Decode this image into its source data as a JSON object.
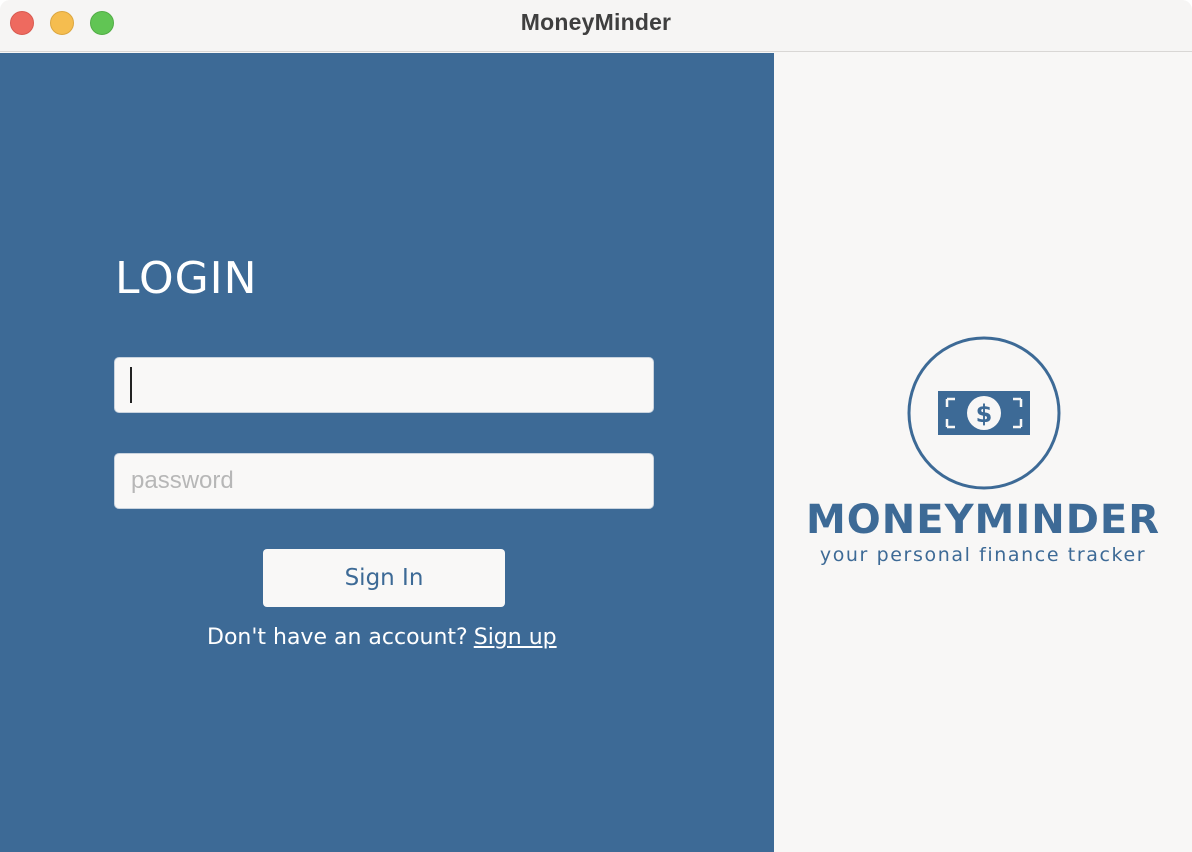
{
  "window": {
    "title": "MoneyMinder"
  },
  "login": {
    "heading": "LOGIN",
    "username": {
      "value": "",
      "placeholder": ""
    },
    "password": {
      "value": "",
      "placeholder": "password"
    },
    "sign_in_label": "Sign In",
    "signup_prompt": "Don't have an account?",
    "signup_link": "Sign up"
  },
  "brand": {
    "name": "MONEYMINDER",
    "tagline": "your personal finance tracker",
    "logo_icon": "dollar-bill-icon"
  },
  "colors": {
    "accent": "#3d6a96",
    "panel_light": "#f8f7f6",
    "traffic_close": "#ee6a5f",
    "traffic_minimize": "#f5bd4f",
    "traffic_zoom": "#61c554"
  }
}
